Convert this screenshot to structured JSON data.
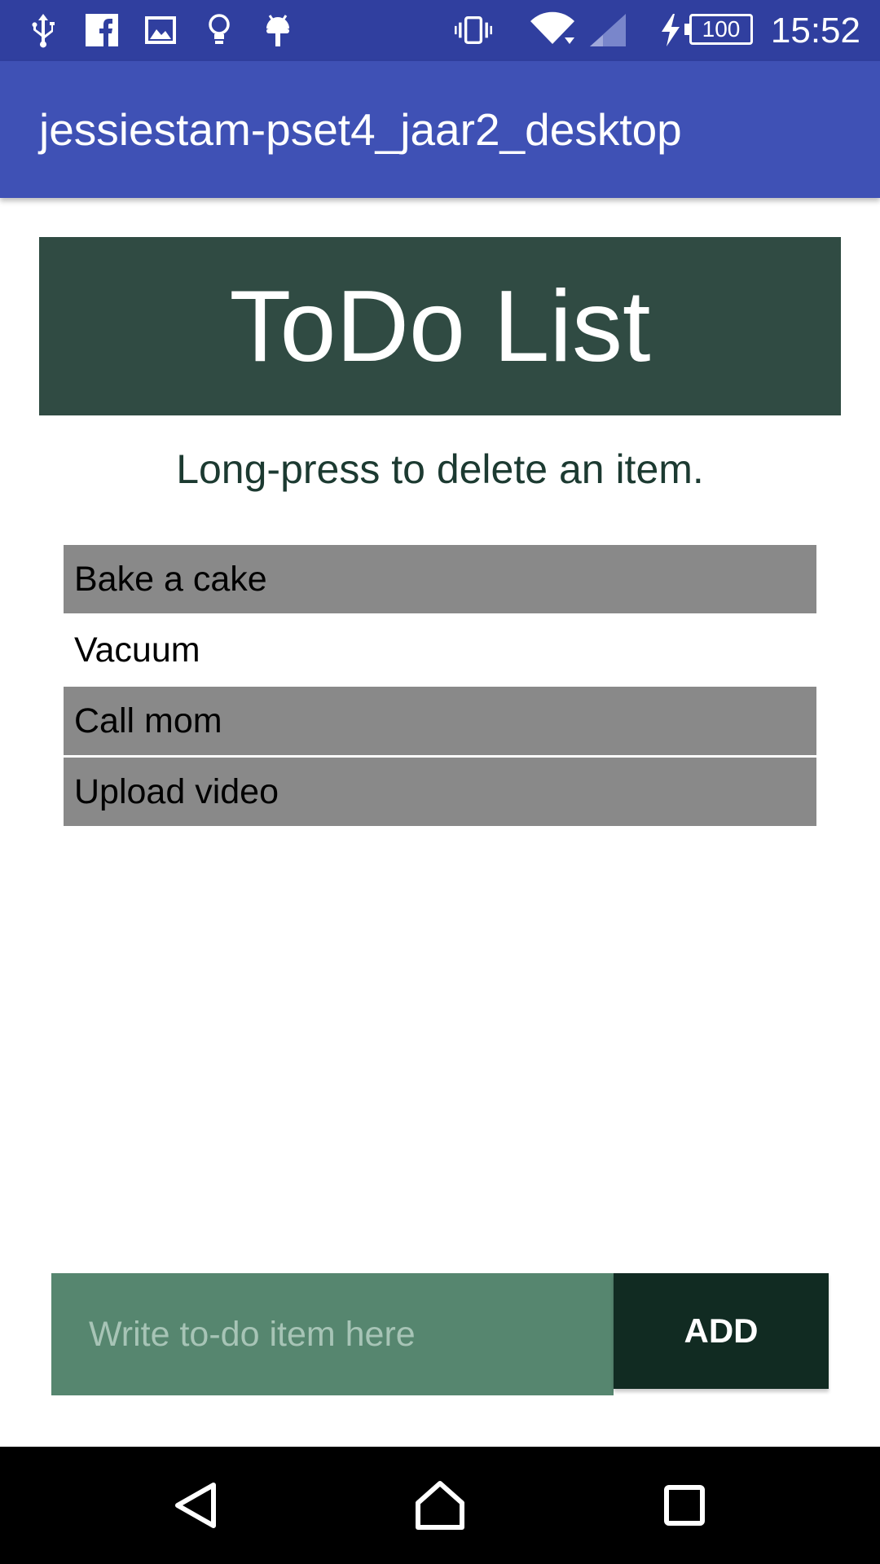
{
  "status_bar": {
    "time": "15:52",
    "battery": "100",
    "icons": [
      "usb-icon",
      "facebook-icon",
      "gallery-icon",
      "lightbulb-icon",
      "android-icon",
      "vibrate-icon",
      "wifi-icon",
      "signal-icon",
      "charging-icon"
    ],
    "colors": {
      "background": "#303f9f"
    }
  },
  "app_bar": {
    "title": "jessiestam-pset4_jaar2_desktop",
    "color": "#3f51b5"
  },
  "banner": {
    "title": "ToDo List",
    "color": "#304b43"
  },
  "hint": "Long-press to delete an item.",
  "list": {
    "items": [
      {
        "label": "Bake a cake",
        "shaded": true
      },
      {
        "label": "Vacuum",
        "shaded": false
      },
      {
        "label": "Call mom",
        "shaded": true
      },
      {
        "label": "Upload video",
        "shaded": true
      }
    ],
    "shade_color": "#898989"
  },
  "input": {
    "placeholder": "Write to-do item here",
    "value": "",
    "color": "#56866f"
  },
  "add_button": {
    "label": "ADD",
    "color": "#112b22"
  },
  "nav_bar": {
    "icons": [
      "back-icon",
      "home-icon",
      "recents-icon"
    ]
  }
}
